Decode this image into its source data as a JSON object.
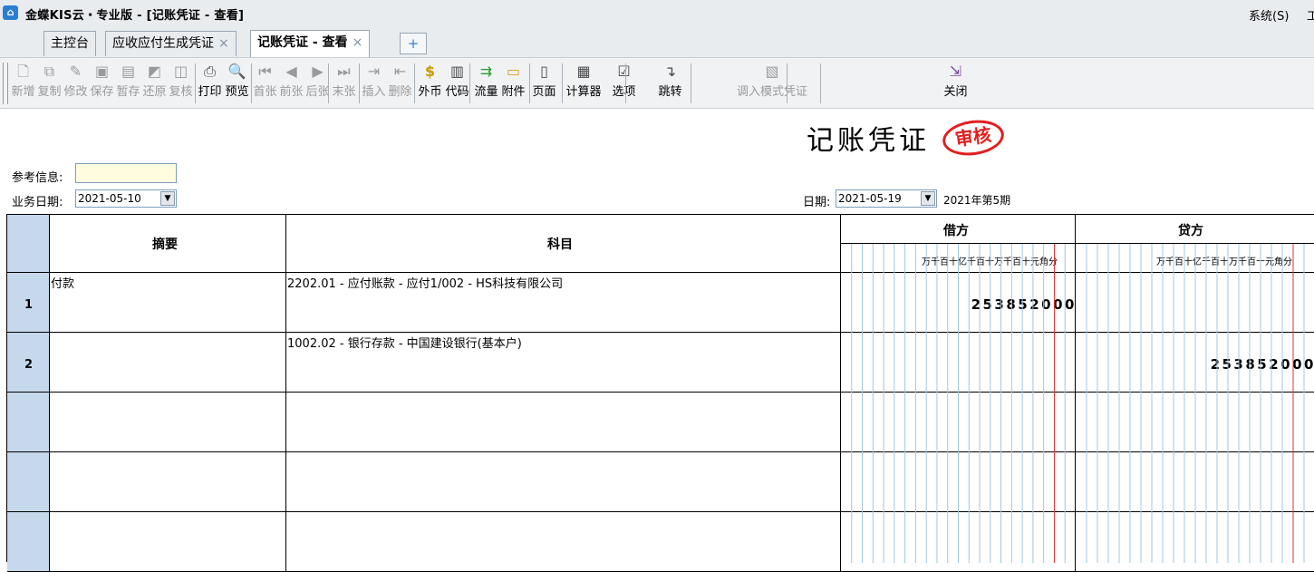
{
  "app": {
    "icon": "kingdee-cloud-icon",
    "title": "金蝶KIS云・专业版 - [记账凭证 - 查看]",
    "system_menu": "系统(S)",
    "system_menu_trailing": "工"
  },
  "tabs": [
    {
      "label": "主控台",
      "closable": false
    },
    {
      "label": "应收应付生成凭证",
      "closable": true
    },
    {
      "label": "记账凭证 - 查看",
      "closable": true,
      "active": true
    }
  ],
  "tab_close_glyph": "×",
  "tab_add_glyph": "+",
  "toolbar": [
    {
      "label": "新增",
      "icon": "new-doc-icon",
      "enabled": false
    },
    {
      "label": "复制",
      "icon": "copy-icon",
      "enabled": false
    },
    {
      "label": "修改",
      "icon": "edit-icon",
      "enabled": false
    },
    {
      "label": "保存",
      "icon": "save-icon",
      "enabled": false
    },
    {
      "label": "暂存",
      "icon": "stash-icon",
      "enabled": false
    },
    {
      "label": "还原",
      "icon": "restore-icon",
      "enabled": false
    },
    {
      "label": "复核",
      "icon": "review-icon",
      "enabled": false
    },
    {
      "label": "打印",
      "icon": "print-icon",
      "enabled": true
    },
    {
      "label": "预览",
      "icon": "preview-icon",
      "enabled": true
    },
    {
      "label": "首张",
      "icon": "first-icon",
      "enabled": false
    },
    {
      "label": "前张",
      "icon": "prev-icon",
      "enabled": false
    },
    {
      "label": "后张",
      "icon": "next-icon",
      "enabled": false
    },
    {
      "label": "末张",
      "icon": "last-icon",
      "enabled": false
    },
    {
      "label": "插入",
      "icon": "insert-row-icon",
      "enabled": false
    },
    {
      "label": "删除",
      "icon": "delete-row-icon",
      "enabled": false
    },
    {
      "label": "外币",
      "icon": "currency-icon",
      "enabled": true
    },
    {
      "label": "代码",
      "icon": "code-icon",
      "enabled": true
    },
    {
      "label": "流量",
      "icon": "cashflow-icon",
      "enabled": true
    },
    {
      "label": "附件",
      "icon": "attachment-folder-icon",
      "enabled": true
    },
    {
      "label": "页面",
      "icon": "page-book-icon",
      "enabled": true
    },
    {
      "label": "计算器",
      "icon": "calculator-icon",
      "enabled": true
    },
    {
      "label": "选项",
      "icon": "options-icon",
      "enabled": true
    },
    {
      "label": "跳转",
      "icon": "jump-arrow-icon",
      "enabled": true
    },
    {
      "label": "调入模式凭证",
      "icon": "template-icon",
      "enabled": false
    },
    {
      "label": "关闭",
      "icon": "exit-door-icon",
      "enabled": true
    }
  ],
  "voucher": {
    "title": "记账凭证",
    "stamp": "审核",
    "ref_label": "参考信息:",
    "ref_value": "",
    "biz_date_label": "业务日期:",
    "biz_date": "2021-05-10",
    "date_label": "日期:",
    "date": "2021-05-19",
    "period": "2021年第5期"
  },
  "grid": {
    "headers": {
      "summary": "摘要",
      "account": "科目",
      "debit": "借方",
      "credit": "贷方",
      "digit_units": "万千百十亿千百十万千百十元角分"
    },
    "rows": [
      {
        "no": "1",
        "summary": "付款",
        "account": "2202.01 - 应付账款 - 应付1/002 - HS科技有限公司",
        "debit": "253852000",
        "credit": ""
      },
      {
        "no": "2",
        "summary": "",
        "account": "1002.02 - 银行存款 - 中国建设银行(基本户)",
        "debit": "",
        "credit": "253852000"
      },
      {
        "no": "",
        "summary": "",
        "account": "",
        "debit": "",
        "credit": ""
      },
      {
        "no": "",
        "summary": "",
        "account": "",
        "debit": "",
        "credit": ""
      },
      {
        "no": "",
        "summary": "",
        "account": "",
        "debit": "",
        "credit": ""
      }
    ]
  },
  "colors": {
    "row_header_bg": "#c6d8ec",
    "stamp_red": "#e02020",
    "digit_line": "#9fc8e0",
    "yuan_line": "#e03030"
  }
}
